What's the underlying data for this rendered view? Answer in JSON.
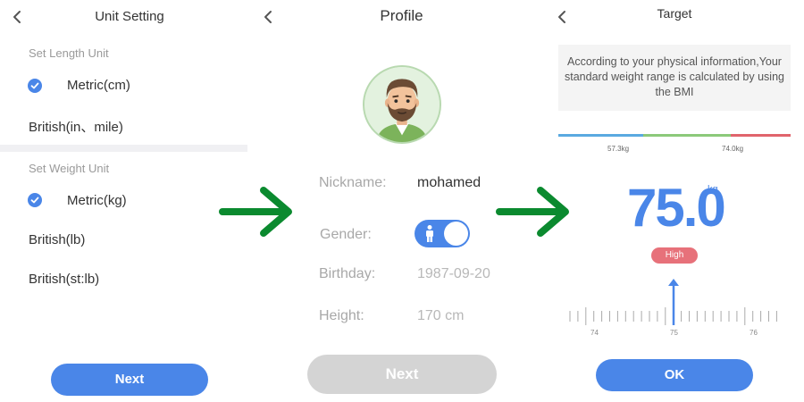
{
  "unit_setting": {
    "title": "Unit Setting",
    "length_section": "Set Length Unit",
    "length_options": [
      "Metric(cm)",
      "British(in、mile)"
    ],
    "weight_section": "Set Weight Unit",
    "weight_options": [
      "Metric(kg)",
      "British(lb)",
      "British(st:lb)"
    ],
    "next_label": "Next"
  },
  "profile": {
    "title": "Profile",
    "nickname_label": "Nickname:",
    "nickname_value": "mohamed",
    "gender_label": "Gender:",
    "birthday_label": "Birthday:",
    "birthday_value": "1987-09-20",
    "height_label": "Height:",
    "height_value": "170 cm",
    "next_label": "Next"
  },
  "target": {
    "title": "Target",
    "info": "According to your physical information,Your standard weight range is calculated by using the BMI",
    "range_low": "57.3kg",
    "range_high": "74.0kg",
    "weight": "75.0",
    "weight_unit": "kg",
    "status": "High",
    "ruler_labels": [
      "74",
      "75",
      "76"
    ],
    "ok_label": "OK"
  },
  "colors": {
    "accent": "#4a86e8",
    "range_blue": "#5aa9e0",
    "range_green": "#8cc97a",
    "range_red": "#e0646c",
    "arrow_green": "#0b8a2f"
  }
}
